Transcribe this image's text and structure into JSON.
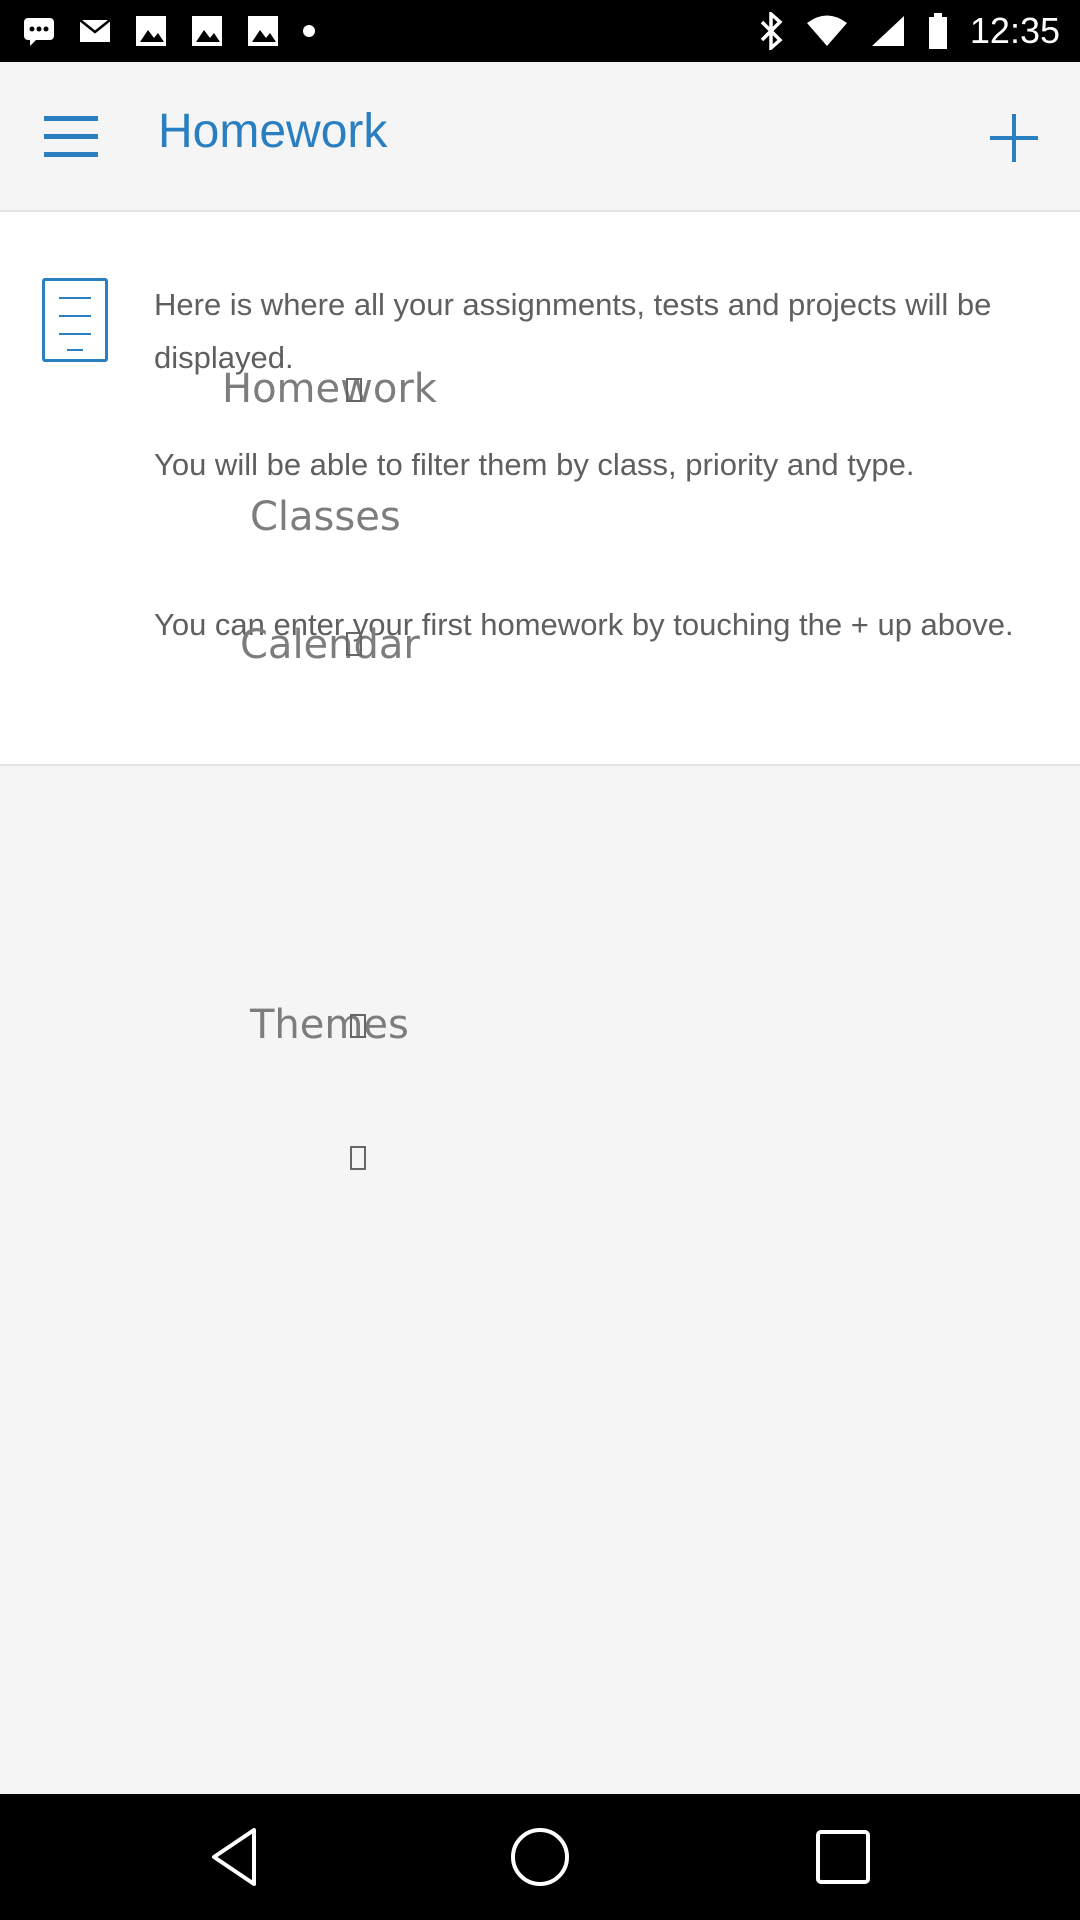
{
  "status_bar": {
    "time": "12:35",
    "left_icons": [
      "messages-icon",
      "mail-icon",
      "image-icon",
      "image-icon",
      "image-icon",
      "dot-icon"
    ],
    "right_icons": [
      "bluetooth-icon",
      "wifi-icon",
      "signal-icon",
      "battery-icon"
    ]
  },
  "app_bar": {
    "title": "Homework",
    "menu_icon": "hamburger-menu-icon",
    "add_icon": "plus-icon"
  },
  "info_card": {
    "icon": "document-icon",
    "paragraphs": [
      "Here is where all your assignments, tests and projects will be displayed.",
      "You will be able to filter them by class, priority and type.",
      "You can enter your first homework by touching the + up above."
    ]
  },
  "ghost_drawer": {
    "items": [
      "Homework",
      "Classes",
      "Calendar",
      "Themes"
    ]
  },
  "colors": {
    "accent": "#2a7fc1",
    "background": "#f5f5f5",
    "card": "#ffffff",
    "body_text": "#5f5f5f"
  },
  "nav_bar": {
    "icons": [
      "back-icon",
      "home-icon",
      "recents-icon"
    ]
  }
}
